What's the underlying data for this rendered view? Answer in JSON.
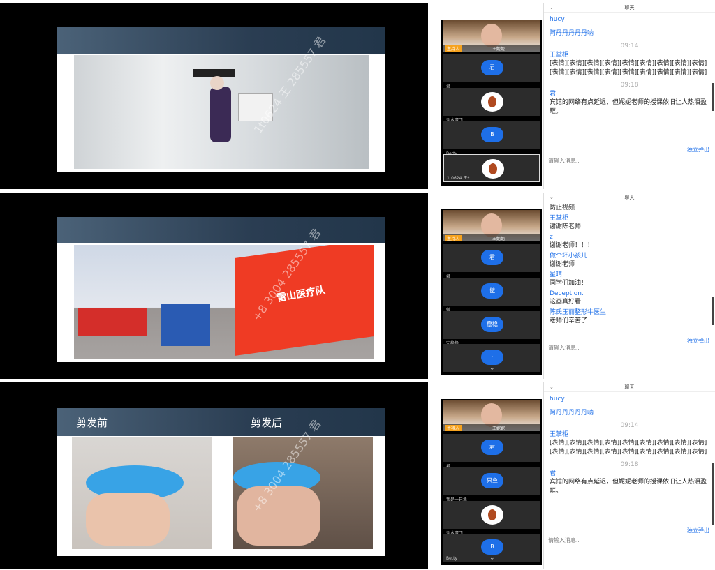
{
  "panels": [
    {
      "chat_title": "聊天",
      "host_label": "主持人",
      "host_name": "王妮妮",
      "participants": [
        {
          "avatar": "君",
          "name": "君"
        },
        {
          "avatar": "",
          "name": "淡水鹰飞"
        },
        {
          "avatar": "B",
          "name": "Betty"
        },
        {
          "avatar": "",
          "name": "1t0624 王*"
        }
      ],
      "messages": [
        {
          "user": "hucy",
          "text": ""
        },
        {
          "user": "",
          "text": "阿丹丹丹丹丹呐"
        },
        {
          "time": "09:14"
        },
        {
          "user": "王掌柜",
          "text": "[表情][表情][表情][表情][表情][表情][表情][表情][表情][表情][表情][表情][表情][表情][表情][表情][表情][表情]"
        },
        {
          "time": "09:18"
        },
        {
          "user": "君",
          "text": "宾馆的网络有点延迟，但妮妮老师的授课依旧让人热泪盈眶。"
        }
      ],
      "popout": "独立弹出",
      "input_placeholder": "请输入消息...",
      "watermark": "1t0624 王 285557 君"
    },
    {
      "chat_title": "聊天",
      "host_label": "主持人",
      "host_name": "王妮妮",
      "participants": [
        {
          "avatar": "君",
          "name": "君"
        },
        {
          "avatar": "傲",
          "name": "傲"
        },
        {
          "avatar": "稳稳",
          "name": "安稳稳"
        },
        {
          "avatar": "·",
          "name": "·"
        }
      ],
      "messages": [
        {
          "user": "",
          "text": "防止视频"
        },
        {
          "user": "王掌柜",
          "text": "谢谢陈老师"
        },
        {
          "user": "z",
          "text": "谢谢老师！！！"
        },
        {
          "user": "做个坏小孩儿",
          "text": "谢谢老师"
        },
        {
          "user": "星晴",
          "text": "同学们加油！"
        },
        {
          "user": "Deception.",
          "text": "这画真好看"
        },
        {
          "user": "陈氏玉丽整形牛医生",
          "text": "老师们辛苦了"
        }
      ],
      "popout": "独立弹出",
      "input_placeholder": "请输入消息...",
      "watermark": "+8 3004 285557 君",
      "flag_text": "雷山医疗队"
    },
    {
      "chat_title": "聊天",
      "host_label": "主持人",
      "host_name": "王妮妮",
      "participants": [
        {
          "avatar": "君",
          "name": "君"
        },
        {
          "avatar": "只鱼",
          "name": "我是一只鱼"
        },
        {
          "avatar": "",
          "name": "淡水鹰飞"
        },
        {
          "avatar": "B",
          "name": "Betty"
        }
      ],
      "messages": [
        {
          "user": "hucy",
          "text": ""
        },
        {
          "user": "",
          "text": "阿丹丹丹丹丹呐"
        },
        {
          "time": "09:14"
        },
        {
          "user": "王掌柜",
          "text": "[表情][表情][表情][表情][表情][表情][表情][表情][表情][表情][表情][表情][表情][表情][表情][表情][表情][表情]"
        },
        {
          "time": "09:18"
        },
        {
          "user": "君",
          "text": "宾馆的网络有点延迟，但妮妮老师的授课依旧让人热泪盈眶。"
        }
      ],
      "popout": "独立弹出",
      "input_placeholder": "请输入消息...",
      "watermark": "+8 3004 285557 君",
      "slide_left_title": "剪发前",
      "slide_right_title": "剪发后"
    }
  ]
}
